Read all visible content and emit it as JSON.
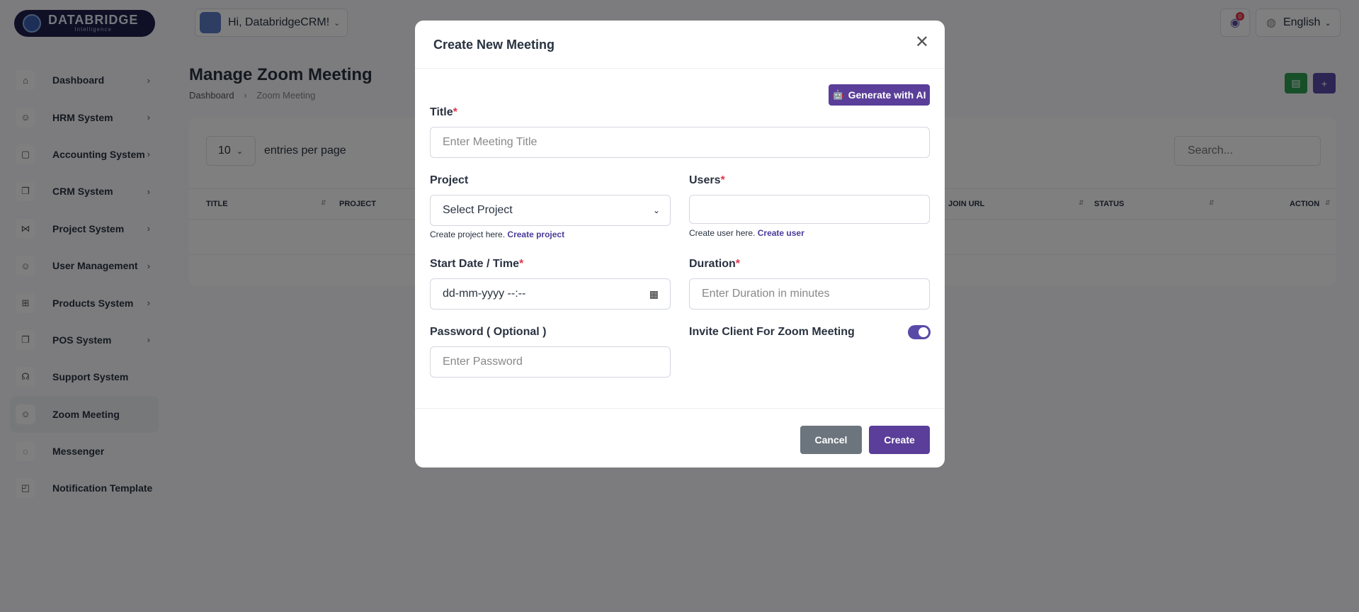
{
  "brand": {
    "name": "DATABRIDGE",
    "tagline": "Intelligence"
  },
  "sidebar": {
    "items": [
      {
        "label": "Dashboard",
        "icon": "home-icon",
        "glyph": "⌂",
        "has_children": true
      },
      {
        "label": "HRM System",
        "icon": "user-icon",
        "glyph": "☺",
        "has_children": true
      },
      {
        "label": "Accounting System",
        "icon": "box-icon",
        "glyph": "▢",
        "has_children": true
      },
      {
        "label": "CRM System",
        "icon": "layers-icon",
        "glyph": "❐",
        "has_children": true
      },
      {
        "label": "Project System",
        "icon": "share-icon",
        "glyph": "⋈",
        "has_children": true
      },
      {
        "label": "User Management",
        "icon": "users-icon",
        "glyph": "☺",
        "has_children": true
      },
      {
        "label": "Products System",
        "icon": "cart-icon",
        "glyph": "⊞",
        "has_children": true
      },
      {
        "label": "POS System",
        "icon": "layers-icon",
        "glyph": "❐",
        "has_children": true
      },
      {
        "label": "Support System",
        "icon": "headset-icon",
        "glyph": "☊",
        "has_children": false
      },
      {
        "label": "Zoom Meeting",
        "icon": "user-check-icon",
        "glyph": "☺",
        "has_children": false,
        "active": true
      },
      {
        "label": "Messenger",
        "icon": "message-icon",
        "glyph": "◌",
        "has_children": false
      },
      {
        "label": "Notification Template",
        "icon": "notification-icon",
        "glyph": "◰",
        "has_children": false
      }
    ]
  },
  "header": {
    "greeting": "Hi, DatabridgeCRM!",
    "notification_count": "0",
    "language": "English"
  },
  "page": {
    "title": "Manage Zoom Meeting",
    "breadcrumb": [
      "Dashboard",
      "Zoom Meeting"
    ]
  },
  "table": {
    "entries_value": "10",
    "entries_label": "entries per page",
    "search_placeholder": "Search...",
    "columns": [
      "TITLE",
      "PROJECT",
      "JOIN URL",
      "STATUS",
      "ACTION"
    ]
  },
  "modal": {
    "title": "Create New Meeting",
    "ai_button": "Generate with AI",
    "fields": {
      "title": {
        "label": "Title",
        "placeholder": "Enter Meeting Title"
      },
      "project": {
        "label": "Project",
        "value": "Select Project",
        "hint": "Create project here.",
        "hint_link": "Create project"
      },
      "users": {
        "label": "Users",
        "hint": "Create user here.",
        "hint_link": "Create user"
      },
      "start": {
        "label": "Start Date / Time",
        "placeholder": "dd-mm-yyyy --:--"
      },
      "duration": {
        "label": "Duration",
        "placeholder": "Enter Duration in minutes"
      },
      "password": {
        "label": "Password ( Optional )",
        "placeholder": "Enter Password"
      },
      "invite": {
        "label": "Invite Client For Zoom Meeting",
        "enabled": true
      }
    },
    "cancel": "Cancel",
    "create": "Create"
  },
  "colors": {
    "primary": "#5a3e99",
    "success": "#2e9e53",
    "danger": "#e2364b",
    "secondary": "#6c757d"
  }
}
